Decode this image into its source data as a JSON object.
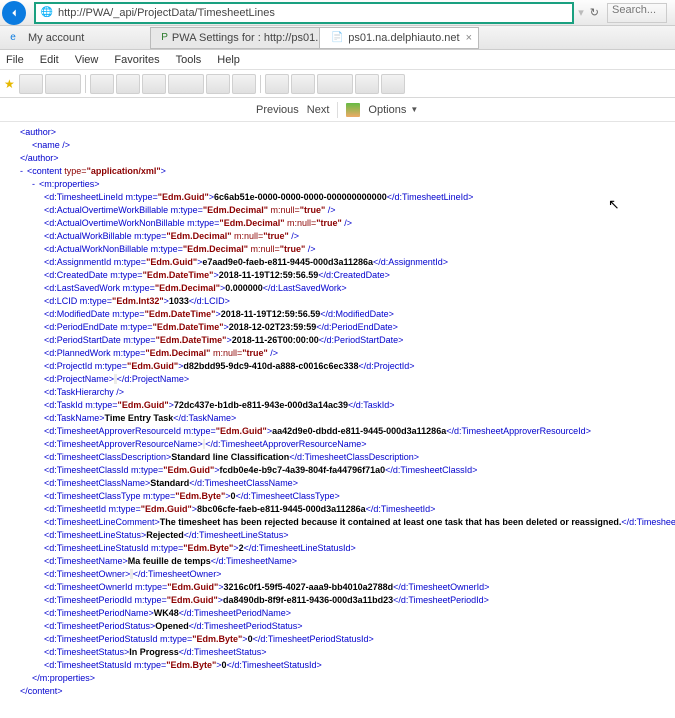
{
  "browser": {
    "scheme": "http://",
    "host_hidden": "         ",
    "path": "PWA/_api/ProjectData/TimesheetLines",
    "search_placeholder": "Search...",
    "tab_home": "My account",
    "tab_mid": "PWA Settings for : http://ps01.",
    "tab_active": "ps01.na.delphiauto.net"
  },
  "menu": {
    "file": "File",
    "edit": "Edit",
    "view": "View",
    "favorites": "Favorites",
    "tools": "Tools",
    "help": "Help"
  },
  "pager": {
    "prev": "Previous",
    "next": "Next",
    "options": "Options"
  },
  "xml": {
    "author_open": "<author>",
    "name_self": "<name />",
    "author_close": "</author>",
    "content_open_a": "<content ",
    "content_type_attr": "type=",
    "content_type_val": "\"application/xml\"",
    "content_open_b": ">",
    "mprops_open": "<m:properties>",
    "lines": [
      {
        "o": "<d:TimesheetLineId m:type=",
        "t": "\"Edm.Guid\"",
        "c": ">",
        "v": "6c6ab51e-0000-0000-0000-000000000000",
        "e": "</d:TimesheetLineId>"
      },
      {
        "o": "<d:ActualOvertimeWorkBillable m:type=",
        "t": "\"Edm.Decimal\"",
        "a": " m:null=",
        "av": "\"true\"",
        "self": " />"
      },
      {
        "o": "<d:ActualOvertimeWorkNonBillable m:type=",
        "t": "\"Edm.Decimal\"",
        "a": " m:null=",
        "av": "\"true\"",
        "self": " />"
      },
      {
        "o": "<d:ActualWorkBillable m:type=",
        "t": "\"Edm.Decimal\"",
        "a": " m:null=",
        "av": "\"true\"",
        "self": " />"
      },
      {
        "o": "<d:ActualWorkNonBillable m:type=",
        "t": "\"Edm.Decimal\"",
        "a": " m:null=",
        "av": "\"true\"",
        "self": " />"
      },
      {
        "o": "<d:AssignmentId m:type=",
        "t": "\"Edm.Guid\"",
        "c": ">",
        "v": "e7aad9e0-faeb-e811-9445-000d3a11286a",
        "e": "</d:AssignmentId>"
      },
      {
        "o": "<d:CreatedDate m:type=",
        "t": "\"Edm.DateTime\"",
        "c": ">",
        "v": "2018-11-19T12:59:56.59",
        "e": "</d:CreatedDate>"
      },
      {
        "o": "<d:LastSavedWork m:type=",
        "t": "\"Edm.Decimal\"",
        "c": ">",
        "v": "0.000000",
        "e": "</d:LastSavedWork>"
      },
      {
        "o": "<d:LCID m:type=",
        "t": "\"Edm.Int32\"",
        "c": ">",
        "v": "1033",
        "e": "</d:LCID>"
      },
      {
        "o": "<d:ModifiedDate m:type=",
        "t": "\"Edm.DateTime\"",
        "c": ">",
        "v": "2018-11-19T12:59:56.59",
        "e": "</d:ModifiedDate>"
      },
      {
        "o": "<d:PeriodEndDate m:type=",
        "t": "\"Edm.DateTime\"",
        "c": ">",
        "v": "2018-12-02T23:59:59",
        "e": "</d:PeriodEndDate>"
      },
      {
        "o": "<d:PeriodStartDate m:type=",
        "t": "\"Edm.DateTime\"",
        "c": ">",
        "v": "2018-11-26T00:00:00",
        "e": "</d:PeriodStartDate>"
      },
      {
        "o": "<d:PlannedWork m:type=",
        "t": "\"Edm.Decimal\"",
        "a": " m:null=",
        "av": "\"true\"",
        "self": " />"
      },
      {
        "o": "<d:ProjectId m:type=",
        "t": "\"Edm.Guid\"",
        "c": ">",
        "v": "d82bdd95-9dc9-410d-a888-c0016c6ec338",
        "e": "</d:ProjectId>"
      },
      {
        "o": "<d:ProjectName>",
        "blank": "                              ",
        "e": "</d:ProjectName>"
      },
      {
        "o": "<d:TaskHierarchy />"
      },
      {
        "o": "<d:TaskId m:type=",
        "t": "\"Edm.Guid\"",
        "c": ">",
        "v": "72dc437e-b1db-e811-943e-000d3a14ac39",
        "e": "</d:TaskId>"
      },
      {
        "o": "<d:TaskName>",
        "v": "Time Entry Task",
        "e": "</d:TaskName>"
      },
      {
        "o": "<d:TimesheetApproverResourceId m:type=",
        "t": "\"Edm.Guid\"",
        "c": ">",
        "v": "aa42d9e0-dbdd-e811-9445-000d3a11286a",
        "e": "</d:TimesheetApproverResourceId>"
      },
      {
        "o": "<d:TimesheetApproverResourceName>",
        "blank": "                    ",
        "e": "</d:TimesheetApproverResourceName>"
      },
      {
        "o": "<d:TimesheetClassDescription>",
        "v": "Standard line Classification",
        "e": "</d:TimesheetClassDescription>"
      },
      {
        "o": "<d:TimesheetClassId m:type=",
        "t": "\"Edm.Guid\"",
        "c": ">",
        "v": "fcdb0e4e-b9c7-4a39-804f-fa44796f71a0",
        "e": "</d:TimesheetClassId>"
      },
      {
        "o": "<d:TimesheetClassName>",
        "v": "Standard",
        "e": "</d:TimesheetClassName>"
      },
      {
        "o": "<d:TimesheetClassType m:type=",
        "t": "\"Edm.Byte\"",
        "c": ">",
        "v": "0",
        "e": "</d:TimesheetClassType>"
      },
      {
        "o": "<d:TimesheetId m:type=",
        "t": "\"Edm.Guid\"",
        "c": ">",
        "v": "8bc06cfe-faeb-e811-9445-000d3a11286a",
        "e": "</d:TimesheetId>"
      },
      {
        "o": "<d:TimesheetLineComment>",
        "v": "The timesheet has been rejected because it contained at least one task that has been deleted or reassigned.",
        "e": "</d:TimesheetLineComment>"
      },
      {
        "o": "<d:TimesheetLineStatus>",
        "v": "Rejected",
        "e": "</d:TimesheetLineStatus>"
      },
      {
        "o": "<d:TimesheetLineStatusId m:type=",
        "t": "\"Edm.Byte\"",
        "c": ">",
        "v": "2",
        "e": "</d:TimesheetLineStatusId>"
      },
      {
        "o": "<d:TimesheetName>",
        "v": "Ma feuille de temps",
        "e": "</d:TimesheetName>"
      },
      {
        "o": "<d:TimesheetOwner>",
        "blank": "              ",
        "e": "</d:TimesheetOwner>"
      },
      {
        "o": "<d:TimesheetOwnerId m:type=",
        "t": "\"Edm.Guid\"",
        "c": ">",
        "v": "3216c0f1-59f5-4027-aaa9-bb4010a2788d",
        "e": "</d:TimesheetOwnerId>"
      },
      {
        "o": "<d:TimesheetPeriodId m:type=",
        "t": "\"Edm.Guid\"",
        "c": ">",
        "v": "da8490db-8f9f-e811-9436-000d3a11bd23",
        "e": "</d:TimesheetPeriodId>"
      },
      {
        "o": "<d:TimesheetPeriodName>",
        "v": "WK48",
        "e": "</d:TimesheetPeriodName>"
      },
      {
        "o": "<d:TimesheetPeriodStatus>",
        "v": "Opened",
        "e": "</d:TimesheetPeriodStatus>"
      },
      {
        "o": "<d:TimesheetPeriodStatusId m:type=",
        "t": "\"Edm.Byte\"",
        "c": ">",
        "v": "0",
        "e": "</d:TimesheetPeriodStatusId>"
      },
      {
        "o": "<d:TimesheetStatus>",
        "v": "In Progress",
        "e": "</d:TimesheetStatus>"
      },
      {
        "o": "<d:TimesheetStatusId m:type=",
        "t": "\"Edm.Byte\"",
        "c": ">",
        "v": "0",
        "e": "</d:TimesheetStatusId>"
      }
    ],
    "mprops_close": "</m:properties>",
    "content_close": "</content>"
  }
}
